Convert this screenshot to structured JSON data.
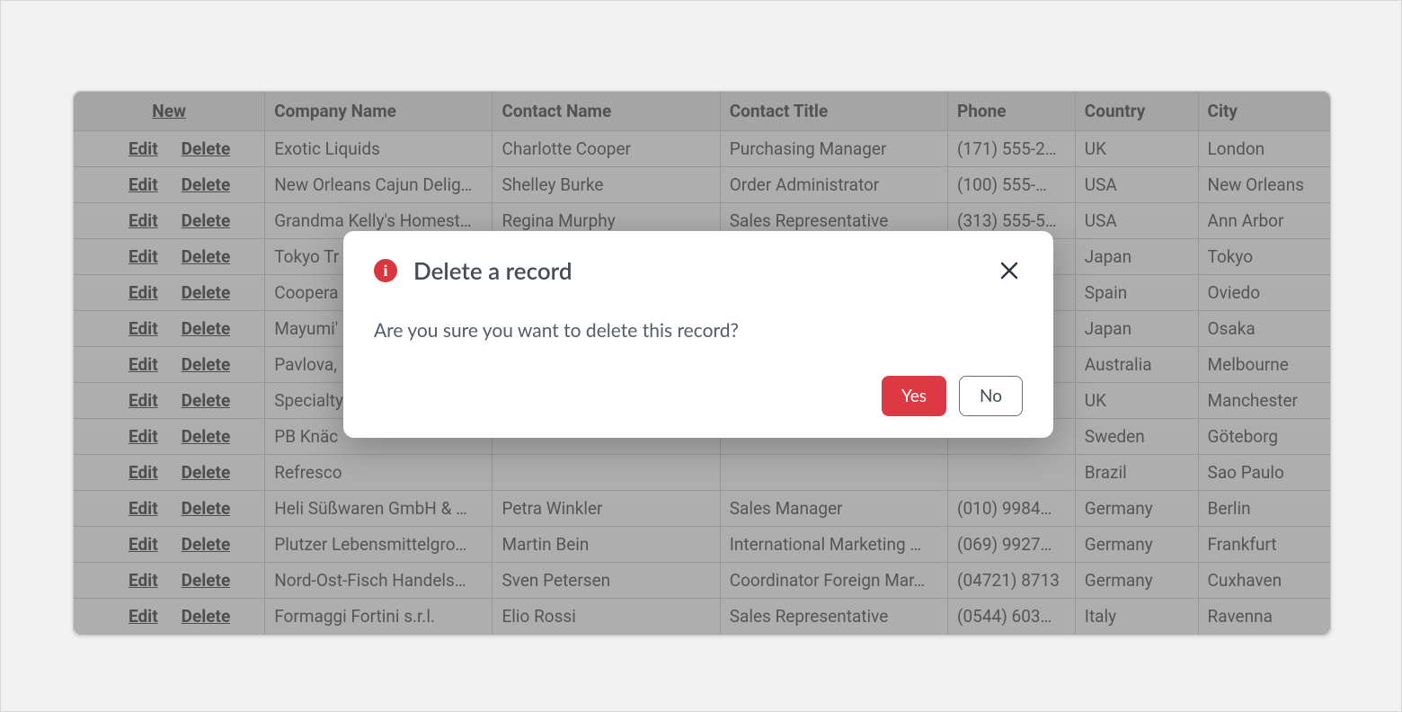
{
  "grid": {
    "actions": {
      "new": "New",
      "edit": "Edit",
      "delete": "Delete"
    },
    "headers": {
      "company": "Company Name",
      "contact": "Contact Name",
      "title": "Contact Title",
      "phone": "Phone",
      "country": "Country",
      "city": "City"
    },
    "rows": [
      {
        "company": "Exotic Liquids",
        "contact": "Charlotte Cooper",
        "title": "Purchasing Manager",
        "phone": "(171) 555-2…",
        "country": "UK",
        "city": "London"
      },
      {
        "company": "New Orleans Cajun Delig…",
        "contact": "Shelley Burke",
        "title": "Order Administrator",
        "phone": "(100) 555-…",
        "country": "USA",
        "city": "New Orleans"
      },
      {
        "company": "Grandma Kelly's Homest…",
        "contact": "Regina Murphy",
        "title": "Sales Representative",
        "phone": "(313) 555-5…",
        "country": "USA",
        "city": "Ann Arbor"
      },
      {
        "company": "Tokyo Tr",
        "contact": "",
        "title": "",
        "phone": "",
        "country": "Japan",
        "city": "Tokyo"
      },
      {
        "company": "Coopera",
        "contact": "",
        "title": "",
        "phone": "",
        "country": "Spain",
        "city": "Oviedo"
      },
      {
        "company": "Mayumi'",
        "contact": "",
        "title": "",
        "phone": "…",
        "country": "Japan",
        "city": "Osaka"
      },
      {
        "company": "Pavlova,",
        "contact": "",
        "title": "",
        "phone": "",
        "country": "Australia",
        "city": "Melbourne"
      },
      {
        "company": "Specialty",
        "contact": "",
        "title": "",
        "phone": "…",
        "country": "UK",
        "city": "Manchester"
      },
      {
        "company": "PB Knäc",
        "contact": "",
        "title": "",
        "phone": "",
        "country": "Sweden",
        "city": "Göteborg"
      },
      {
        "company": "Refresco",
        "contact": "",
        "title": "",
        "phone": "",
        "country": "Brazil",
        "city": "Sao Paulo"
      },
      {
        "company": "Heli Süßwaren GmbH & …",
        "contact": "Petra Winkler",
        "title": "Sales Manager",
        "phone": "(010) 9984…",
        "country": "Germany",
        "city": "Berlin"
      },
      {
        "company": "Plutzer Lebensmittelgro…",
        "contact": "Martin Bein",
        "title": "International Marketing …",
        "phone": "(069) 9927…",
        "country": "Germany",
        "city": "Frankfurt"
      },
      {
        "company": "Nord-Ost-Fisch Handels…",
        "contact": "Sven Petersen",
        "title": "Coordinator Foreign Mar…",
        "phone": "(04721) 8713",
        "country": "Germany",
        "city": "Cuxhaven"
      },
      {
        "company": "Formaggi Fortini s.r.l.",
        "contact": "Elio Rossi",
        "title": "Sales Representative",
        "phone": "(0544) 603…",
        "country": "Italy",
        "city": "Ravenna"
      }
    ]
  },
  "dialog": {
    "title": "Delete a record",
    "message": "Are you sure you want to delete this record?",
    "yes": "Yes",
    "no": "No"
  }
}
